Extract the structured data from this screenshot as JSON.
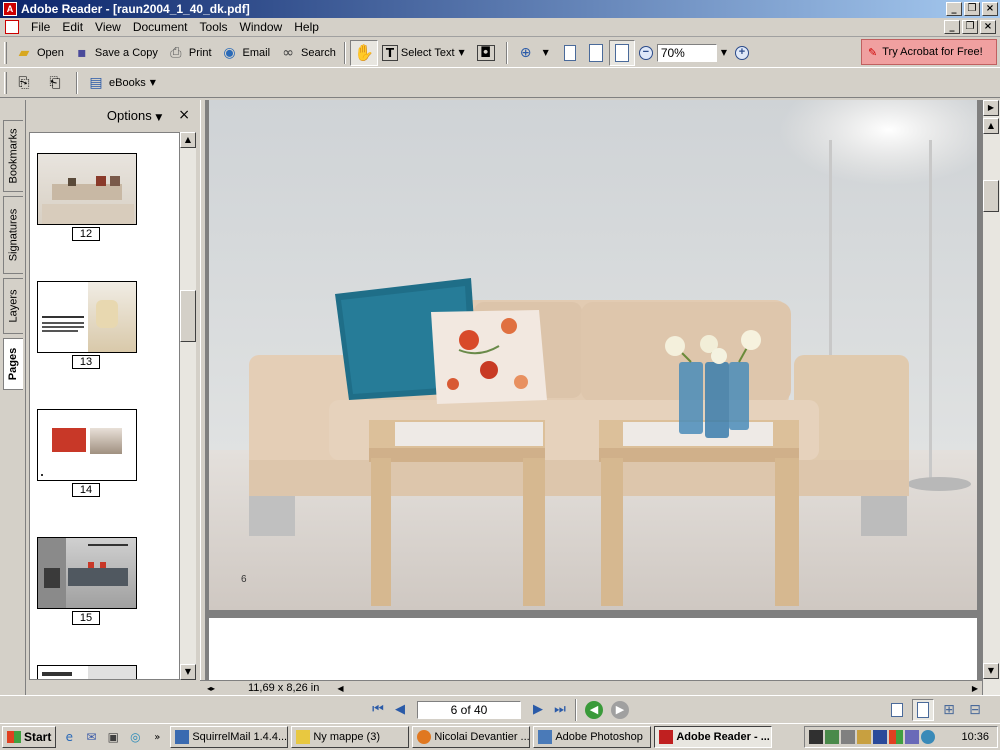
{
  "window": {
    "title": "Adobe Reader - [raun2004_1_40_dk.pdf]",
    "minimize": "_",
    "maximize": "❐",
    "close": "×"
  },
  "menu": [
    "File",
    "Edit",
    "View",
    "Document",
    "Tools",
    "Window",
    "Help"
  ],
  "toolbar": {
    "open": "Open",
    "save_copy": "Save a Copy",
    "print": "Print",
    "email": "Email",
    "search": "Search",
    "select_text": "Select Text",
    "zoom_value": "70%",
    "try_acrobat": "Try Acrobat for Free!",
    "ebooks": "eBooks"
  },
  "side_tabs": [
    "Bookmarks",
    "Signatures",
    "Layers",
    "Pages"
  ],
  "pages_panel": {
    "options": "Options",
    "close": "×",
    "thumbnails": [
      {
        "label": "12"
      },
      {
        "label": "13"
      },
      {
        "label": "14"
      },
      {
        "label": "15"
      }
    ]
  },
  "document": {
    "page_number_printed": "6",
    "page_size": "11,69 x 8,26 in"
  },
  "navigation": {
    "page_indicator": "6 of 40"
  },
  "taskbar": {
    "start": "Start",
    "tasks": [
      {
        "label": "SquirrelMail 1.4.4...",
        "active": false,
        "color": "#3a6ab0"
      },
      {
        "label": "Ny mappe (3)",
        "active": false,
        "color": "#e8c840"
      },
      {
        "label": "Nicolai Devantier ...",
        "active": false,
        "color": "#e07820"
      },
      {
        "label": "Adobe Photoshop",
        "active": false,
        "color": "#4a7ab8"
      },
      {
        "label": "Adobe Reader - ...",
        "active": true,
        "color": "#c02020"
      }
    ],
    "clock": "10:36"
  }
}
